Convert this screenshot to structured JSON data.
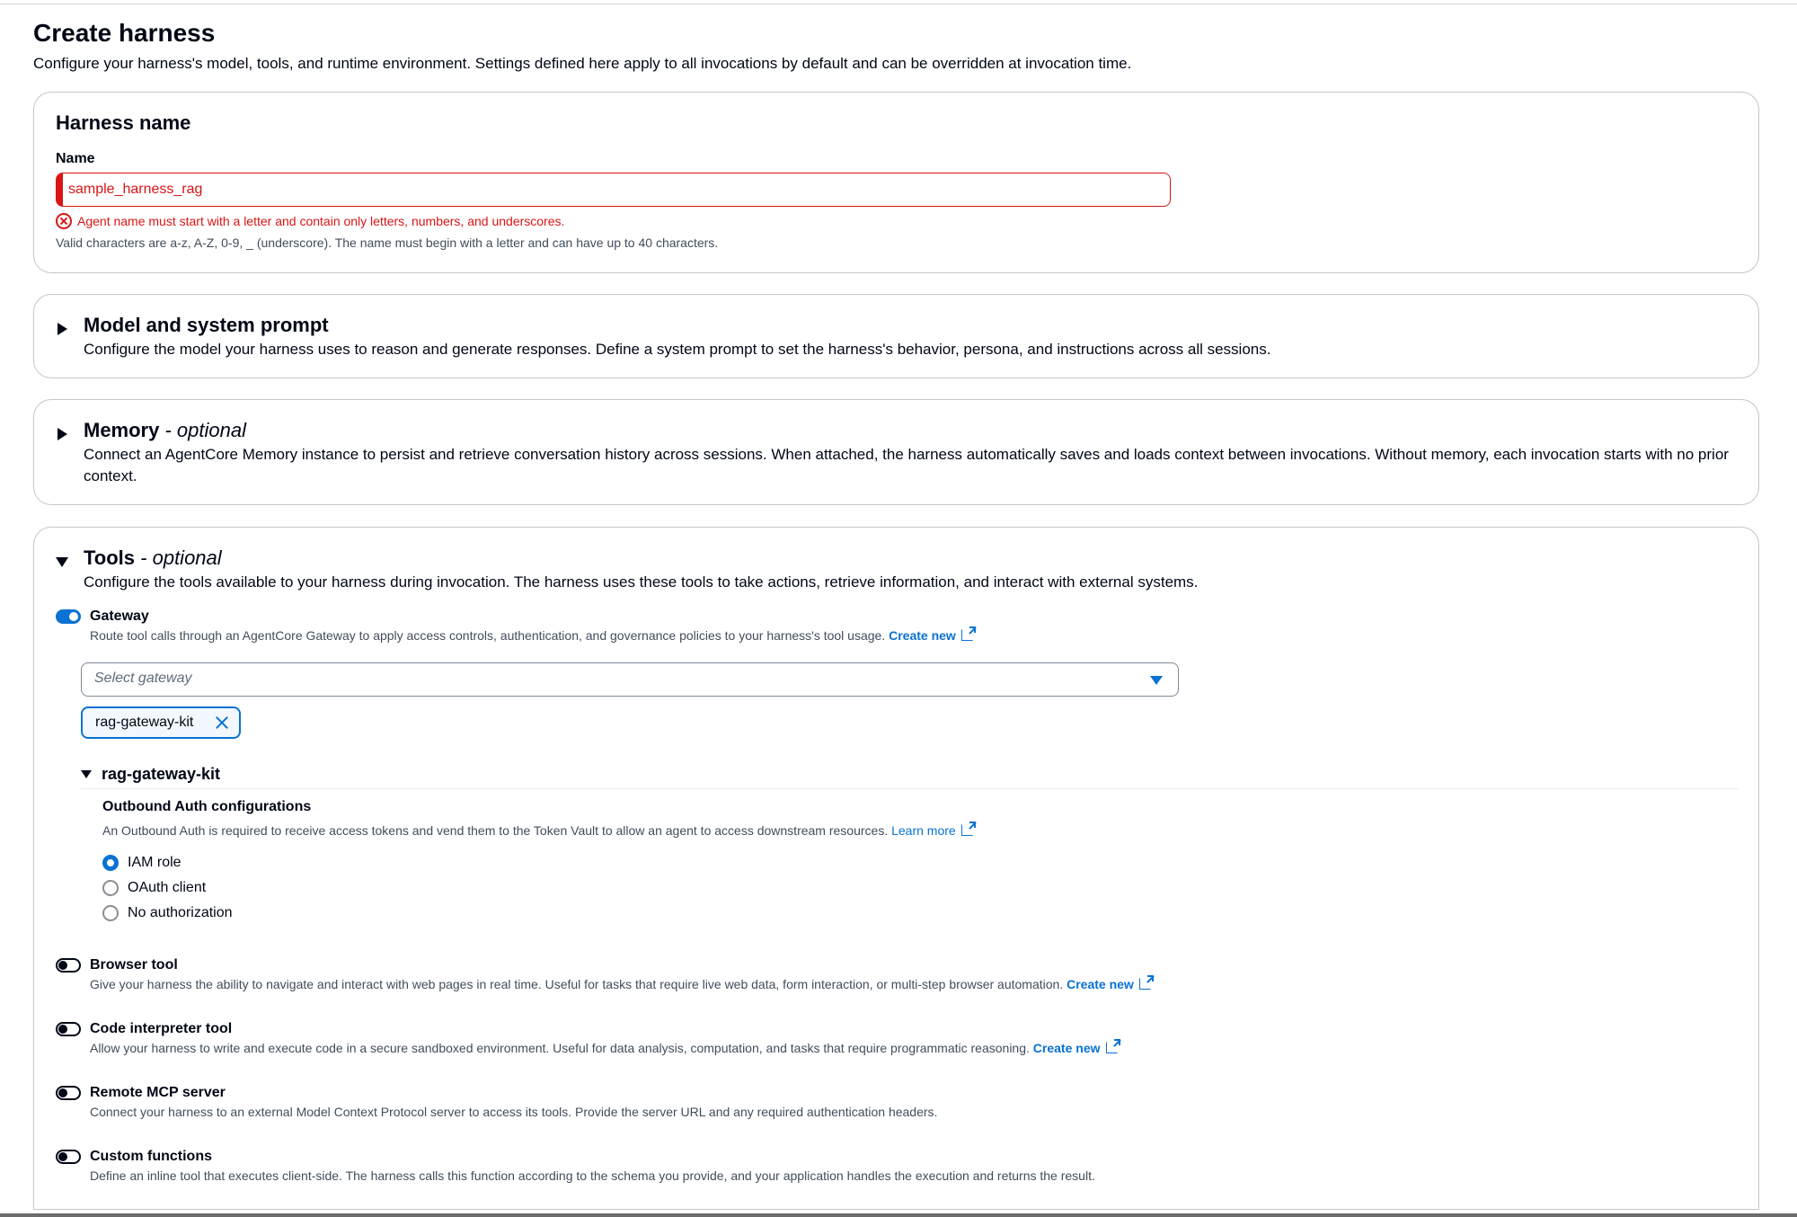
{
  "header": {
    "title": "Create harness",
    "description": "Configure your harness's model, tools, and runtime environment. Settings defined here apply to all invocations by default and can be overridden at invocation time."
  },
  "harness_name": {
    "heading": "Harness name",
    "field_label": "Name",
    "value": "sample_harness_rag",
    "error": "Agent name must start with a letter and contain only letters, numbers, and underscores.",
    "constraint": "Valid characters are a-z, A-Z, 0-9, _ (underscore). The name must begin with a letter and can have up to 40 characters."
  },
  "model": {
    "heading": "Model and system prompt",
    "description": "Configure the model your harness uses to reason and generate responses. Define a system prompt to set the harness's behavior, persona, and instructions across all sessions."
  },
  "memory": {
    "heading": "Memory",
    "optional": "- optional",
    "description": "Connect an AgentCore Memory instance to persist and retrieve conversation history across sessions. When attached, the harness automatically saves and loads context between invocations. Without memory, each invocation starts with no prior context."
  },
  "tools": {
    "heading": "Tools",
    "optional": "- optional",
    "description": "Configure the tools available to your harness during invocation. The harness uses these tools to take actions, retrieve information, and interact with external systems.",
    "gateway": {
      "label": "Gateway",
      "enabled": true,
      "description": "Route tool calls through an AgentCore Gateway to apply access controls, authentication, and governance policies to your harness's tool usage.",
      "create_link": "Create new",
      "select_placeholder": "Select gateway",
      "selected_token": "rag-gateway-kit",
      "expanded_item": "rag-gateway-kit",
      "outbound": {
        "title": "Outbound Auth configurations",
        "description": "An Outbound Auth is required to receive access tokens and vend them to the Token Vault to allow an agent to access downstream resources.",
        "learn_more": "Learn more",
        "options": [
          "IAM role",
          "OAuth client",
          "No authorization"
        ],
        "selected": "IAM role"
      }
    },
    "browser": {
      "label": "Browser tool",
      "enabled": false,
      "description": "Give your harness the ability to navigate and interact with web pages in real time. Useful for tasks that require live web data, form interaction, or multi-step browser automation.",
      "create_link": "Create new"
    },
    "code_interpreter": {
      "label": "Code interpreter tool",
      "enabled": false,
      "description": "Allow your harness to write and execute code in a secure sandboxed environment. Useful for data analysis, computation, and tasks that require programmatic reasoning.",
      "create_link": "Create new"
    },
    "remote_mcp": {
      "label": "Remote MCP server",
      "enabled": false,
      "description": "Connect your harness to an external Model Context Protocol server to access its tools. Provide the server URL and any required authentication headers."
    },
    "custom_functions": {
      "label": "Custom functions",
      "enabled": false,
      "description": "Define an inline tool that executes client-side. The harness calls this function according to the schema you provide, and your application handles the execution and returns the result."
    }
  },
  "colors": {
    "accent": "#0972d3",
    "error": "#d91515",
    "text": "#000716",
    "border": "#c6c6cd"
  }
}
